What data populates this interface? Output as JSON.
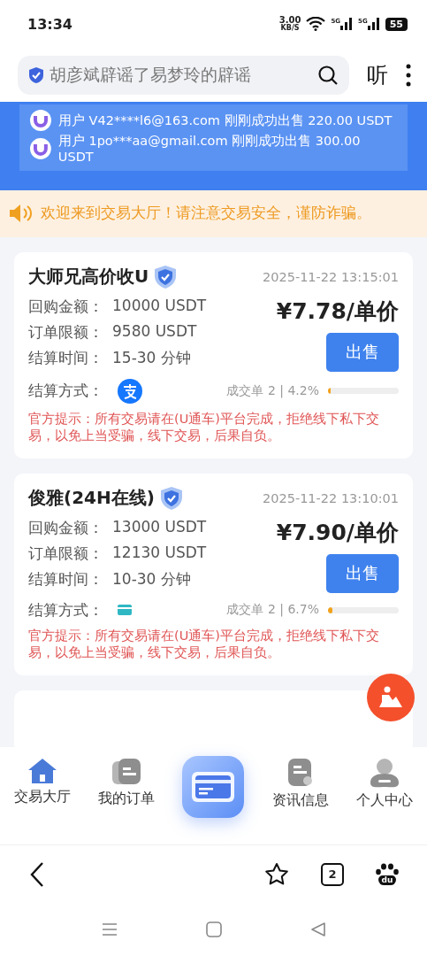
{
  "status_bar": {
    "time": "13:34",
    "speed": "3.00",
    "speed_unit": "KB/S",
    "signals": [
      "5G",
      "5G"
    ],
    "battery": "55"
  },
  "search": {
    "value": "胡彦斌辟谣了易梦玲的辟谣"
  },
  "listen_button": "听",
  "ticker": [
    {
      "text": "用户 V42****l6@163.com 刚刚成功出售 220.00 USDT"
    },
    {
      "text": "用户 1po***aa@gmail.com 刚刚成功出售 300.00 USDT"
    }
  ],
  "notice": "欢迎来到交易大厅！请注意交易安全，谨防诈骗。",
  "offers": [
    {
      "name": "大师兄高价收U",
      "verified": true,
      "time": "2025-11-22 13:15:01",
      "rows": [
        {
          "label": "回购金额：",
          "value": "10000 USDT"
        },
        {
          "label": "订单限额：",
          "value": "9580 USDT"
        },
        {
          "label": "结算时间：",
          "value": "15-30 分钟"
        }
      ],
      "settlement_label": "结算方式：",
      "payment": {
        "kind": "alipay"
      },
      "price": "¥7.78/单价",
      "button": "出售",
      "stats": "成交单 2 | 4.2%",
      "level": 0.042,
      "warning": "官方提示：所有交易请在(U通车)平台完成，拒绝线下私下交易，以免上当受骗，线下交易，后果自负。"
    },
    {
      "name": "俊雅(24H在线)",
      "verified": true,
      "time": "2025-11-22 13:10:01",
      "rows": [
        {
          "label": "回购金额：",
          "value": "13000 USDT"
        },
        {
          "label": "订单限额：",
          "value": "12130 USDT"
        },
        {
          "label": "结算时间：",
          "value": "10-30 分钟"
        }
      ],
      "settlement_label": "结算方式：",
      "payment": {
        "kind": "card"
      },
      "price": "¥7.90/单价",
      "button": "出售",
      "stats": "成交单 2 | 6.7%",
      "level": 0.067,
      "warning": "官方提示：所有交易请在(U通车)平台完成，拒绝线下私下交易，以免上当受骗，线下交易，后果自负。"
    }
  ],
  "tabs": [
    {
      "label": "交易大厅",
      "kind": "home",
      "selected": true
    },
    {
      "label": "我的订单",
      "kind": "orders",
      "selected": false
    },
    {
      "kind": "center",
      "selected": false
    },
    {
      "label": "资讯信息",
      "kind": "news",
      "selected": false
    },
    {
      "label": "个人中心",
      "kind": "user",
      "selected": false
    }
  ],
  "browser": {
    "tab_count": "2",
    "baidu_label": "du"
  }
}
